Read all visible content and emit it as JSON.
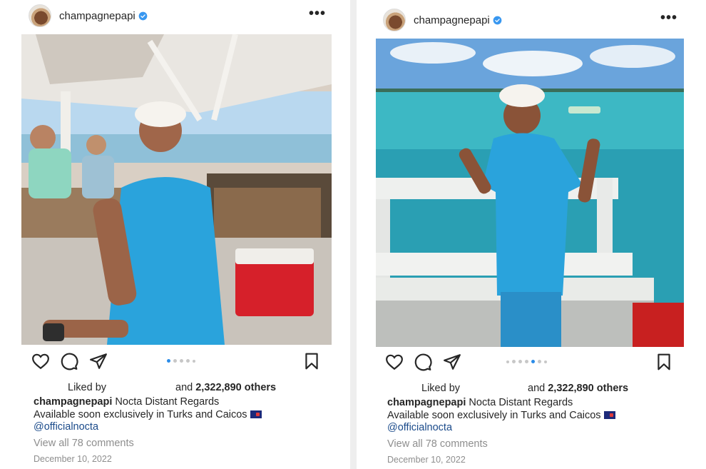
{
  "posts": [
    {
      "username": "champagnepapi",
      "more_icon": "more-horizontal-icon",
      "photo_desc_icon": "post-photo",
      "liked_by_prefix": "Liked by",
      "liked_by_suffix": "and",
      "liked_others": "2,322,890 others",
      "caption_user": "champagnepapi",
      "caption_text": "Nocta Distant Regards",
      "caption_line2": "Available soon exclusively in Turks and Caicos",
      "mention": "@officialnocta",
      "view_comments": "View all 78 comments",
      "date": "December 10, 2022",
      "carousel_active_index": 0,
      "carousel_count": 5
    },
    {
      "username": "champagnepapi",
      "more_icon": "more-horizontal-icon",
      "liked_by_prefix": "Liked by",
      "liked_by_suffix": "and",
      "liked_others": "2,322,890 others",
      "caption_user": "champagnepapi",
      "caption_text": "Nocta Distant Regards",
      "caption_line2": "Available soon exclusively in Turks and Caicos",
      "mention": "@officialnocta",
      "view_comments": "View all 78 comments",
      "date": "December 10, 2022",
      "carousel_active_index": 4,
      "carousel_count": 7
    }
  ],
  "colors": {
    "verified": "#3897f0",
    "carousel_active": "#2b8ce8",
    "shirt": "#2aa3dc",
    "water": "#2a9fb3"
  },
  "more_glyph": "•••"
}
